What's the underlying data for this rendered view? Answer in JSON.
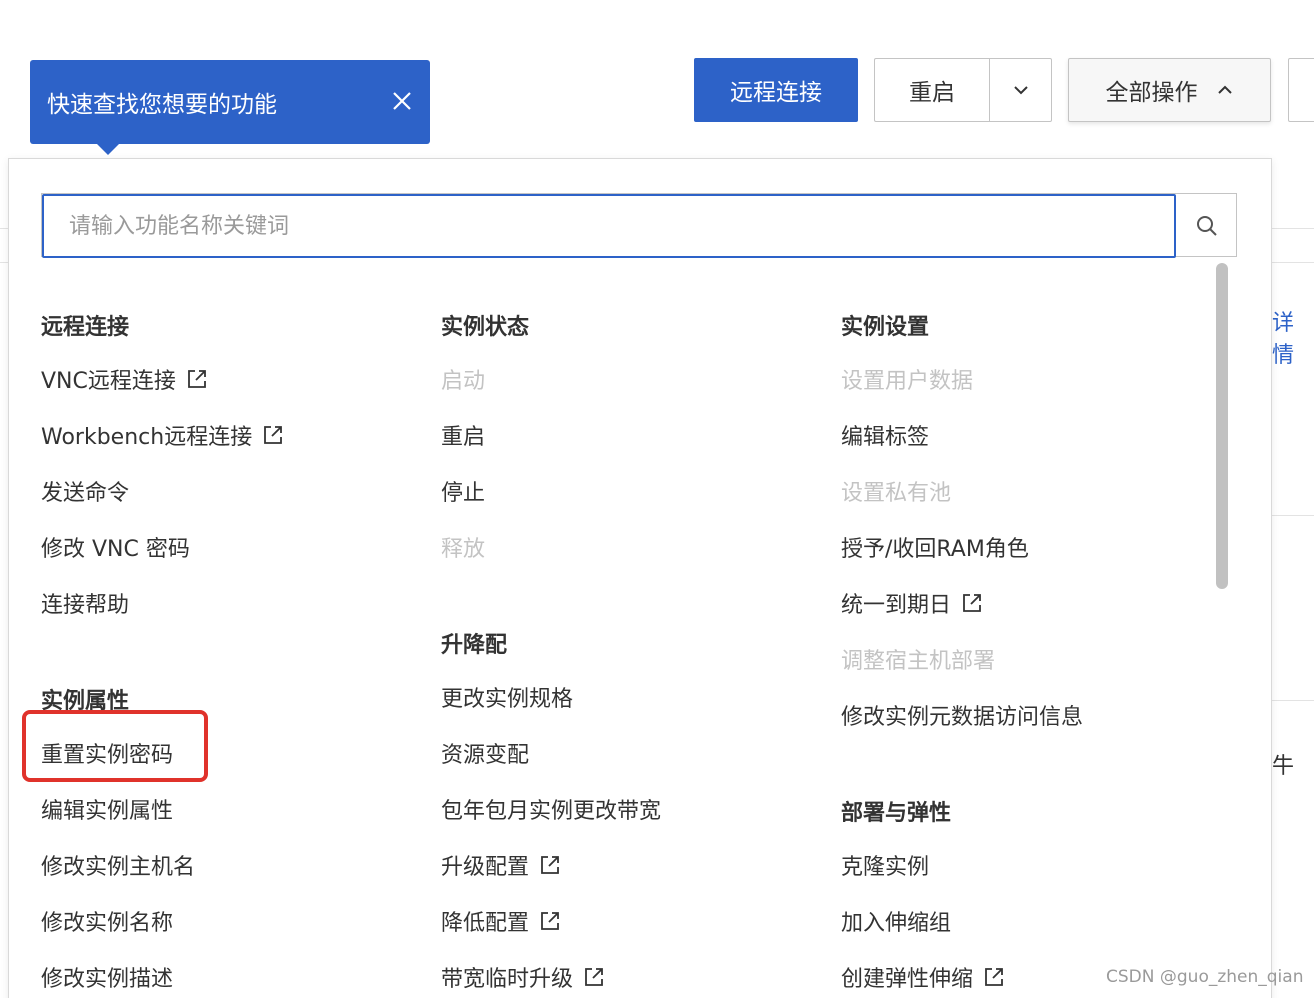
{
  "tooltip": {
    "text": "快速查找您想要的功能",
    "close_icon": "close-icon"
  },
  "toolbar": {
    "remote_connect": "远程连接",
    "restart": "重启",
    "all_operations": "全部操作"
  },
  "search": {
    "placeholder": "请输入功能名称关键词",
    "icon": "search-icon"
  },
  "columns": [
    {
      "sections": [
        {
          "heading": "远程连接",
          "items": [
            {
              "label": "VNC远程连接",
              "external": true,
              "disabled": false
            },
            {
              "label": "Workbench远程连接",
              "external": true,
              "disabled": false
            },
            {
              "label": "发送命令",
              "external": false,
              "disabled": false
            },
            {
              "label": "修改 VNC 密码",
              "external": false,
              "disabled": false
            },
            {
              "label": "连接帮助",
              "external": false,
              "disabled": false
            }
          ]
        },
        {
          "heading": "实例属性",
          "items": [
            {
              "label": "重置实例密码",
              "external": false,
              "disabled": false,
              "highlighted": true
            },
            {
              "label": "编辑实例属性",
              "external": false,
              "disabled": false
            },
            {
              "label": "修改实例主机名",
              "external": false,
              "disabled": false
            },
            {
              "label": "修改实例名称",
              "external": false,
              "disabled": false
            },
            {
              "label": "修改实例描述",
              "external": false,
              "disabled": false
            }
          ]
        }
      ]
    },
    {
      "sections": [
        {
          "heading": "实例状态",
          "items": [
            {
              "label": "启动",
              "external": false,
              "disabled": true
            },
            {
              "label": "重启",
              "external": false,
              "disabled": false
            },
            {
              "label": "停止",
              "external": false,
              "disabled": false
            },
            {
              "label": "释放",
              "external": false,
              "disabled": true
            }
          ]
        },
        {
          "heading": "升降配",
          "items": [
            {
              "label": "更改实例规格",
              "external": false,
              "disabled": false
            },
            {
              "label": "资源变配",
              "external": false,
              "disabled": false
            },
            {
              "label": "包年包月实例更改带宽",
              "external": false,
              "disabled": false
            },
            {
              "label": "升级配置",
              "external": true,
              "disabled": false
            },
            {
              "label": "降低配置",
              "external": true,
              "disabled": false
            },
            {
              "label": "带宽临时升级",
              "external": true,
              "disabled": false
            }
          ]
        }
      ]
    },
    {
      "sections": [
        {
          "heading": "实例设置",
          "items": [
            {
              "label": "设置用户数据",
              "external": false,
              "disabled": true
            },
            {
              "label": "编辑标签",
              "external": false,
              "disabled": false
            },
            {
              "label": "设置私有池",
              "external": false,
              "disabled": true
            },
            {
              "label": "授予/收回RAM角色",
              "external": false,
              "disabled": false
            },
            {
              "label": "统一到期日",
              "external": true,
              "disabled": false
            },
            {
              "label": "调整宿主机部署",
              "external": false,
              "disabled": true
            },
            {
              "label": "修改实例元数据访问信息",
              "external": false,
              "disabled": false
            }
          ]
        },
        {
          "heading": "部署与弹性",
          "items": [
            {
              "label": "克隆实例",
              "external": false,
              "disabled": false
            },
            {
              "label": "加入伸缩组",
              "external": false,
              "disabled": false
            },
            {
              "label": "创建弹性伸缩",
              "external": true,
              "disabled": false
            }
          ]
        }
      ]
    }
  ],
  "background": {
    "right_link": "详情",
    "right_fragment": "牛"
  },
  "watermark": "CSDN @guo_zhen_qian",
  "colors": {
    "primary": "#2d62c8",
    "highlight": "#e0322b",
    "disabled_text": "#c3c3c3"
  }
}
